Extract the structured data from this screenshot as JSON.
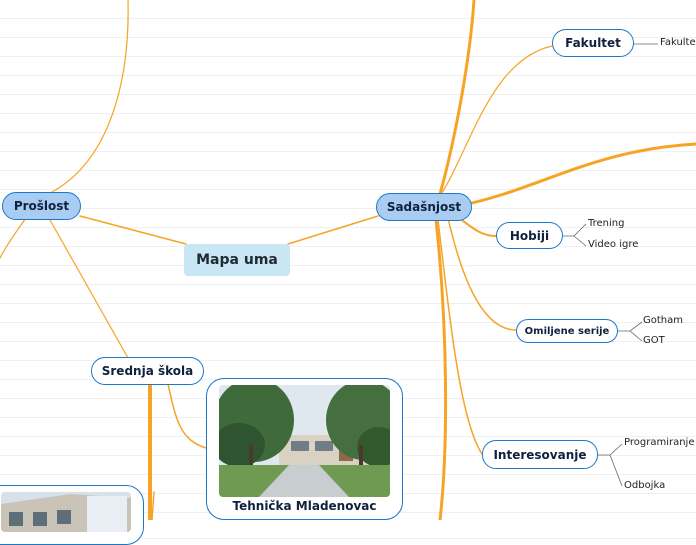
{
  "central": {
    "label": "Mapa uma"
  },
  "topics": {
    "proslost": "Prošlost",
    "sadasnjost": "Sadašnjost",
    "srednja_skola": "Srednja škola",
    "fakultet": "Fakultet",
    "hobiji": "Hobiji",
    "omiljene_serije": "Omiljene serije",
    "interesovanje": "Interesovanje"
  },
  "leaves": {
    "fakultet": "Fakulte",
    "hobiji": [
      "Trening",
      "Video igre"
    ],
    "serije": [
      "Gotham",
      "GOT"
    ],
    "interesovanje": [
      "Programiranje",
      "Odbojka"
    ]
  },
  "image_card": {
    "caption": "Tehnička Mladenovac"
  },
  "colors": {
    "branch": "#f7a426",
    "node_border": "#1b78c9",
    "main_fill": "#a9cdf2",
    "central_fill": "#c9e6f5"
  }
}
